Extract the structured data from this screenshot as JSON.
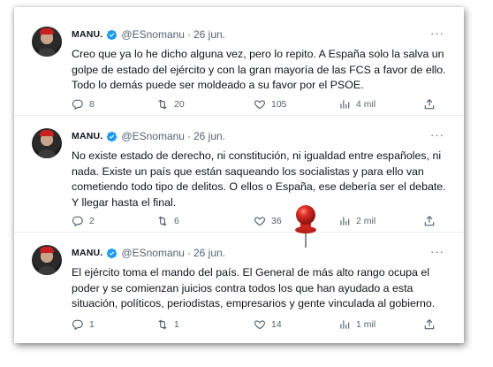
{
  "tweets": [
    {
      "name": "MANU.",
      "handle": "@ESnomanu",
      "dot": "·",
      "date": "26 jun.",
      "text": "Creo que ya lo he dicho alguna vez, pero lo repito. A España solo la salva un golpe de estado del ejército y con la gran mayoría de las FCS a favor de ello. Todo lo demás puede ser moldeado a su favor por el PSOE.",
      "replies": "8",
      "retweets": "20",
      "likes": "105",
      "views": "4 mil"
    },
    {
      "name": "MANU.",
      "handle": "@ESnomanu",
      "dot": "·",
      "date": "26 jun.",
      "text": "No existe estado de derecho, ni constitución, ni igualdad entre españoles, ni nada. Existe un país que están saqueando los socialistas y para ello van cometiendo todo tipo de delitos. O ellos o España, ese debería ser el debate. Y llegar hasta el final.",
      "replies": "2",
      "retweets": "6",
      "likes": "36",
      "views": "2 mil"
    },
    {
      "name": "MANU.",
      "handle": "@ESnomanu",
      "dot": "·",
      "date": "26 jun.",
      "text": "El ejército toma el mando del país. El General de más alto rango ocupa el poder y se comienzan juicios contra todos los que han ayudado a esta situación, políticos, periodistas, empresarios y gente vinculada al gobierno.",
      "replies": "1",
      "retweets": "1",
      "likes": "14",
      "views": "1 mil"
    }
  ],
  "icons": {
    "more": "more-icon",
    "verified": "verified-icon",
    "reply": "reply-icon",
    "retweet": "retweet-icon",
    "like": "like-icon",
    "views": "views-icon",
    "share": "share-icon",
    "pin": "pushpin-icon"
  },
  "colors": {
    "verified": "#1d9bf0",
    "secondary_text": "#536471",
    "pin": "#d42a1e"
  },
  "more_label": "···"
}
